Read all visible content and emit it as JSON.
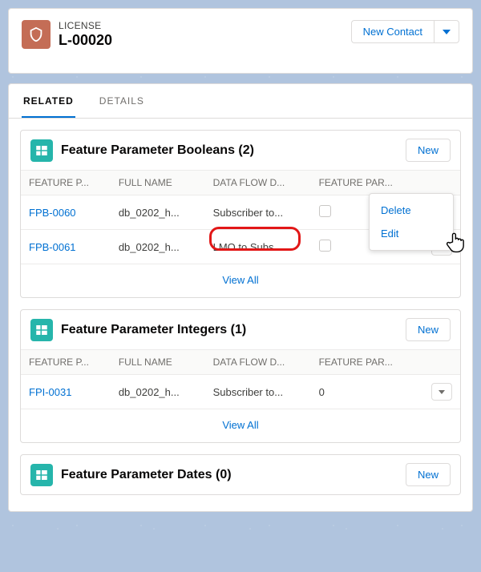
{
  "header": {
    "object_label": "LICENSE",
    "record_name": "L-00020",
    "new_contact_label": "New Contact"
  },
  "tabs": {
    "related": "RELATED",
    "details": "DETAILS"
  },
  "actions": {
    "new": "New",
    "delete": "Delete",
    "edit": "Edit",
    "view_all": "View All"
  },
  "columns": {
    "feature_p": "FEATURE P...",
    "full_name": "FULL NAME",
    "data_flow": "DATA FLOW D...",
    "feature_par": "FEATURE PAR..."
  },
  "booleans": {
    "title": "Feature Parameter Booleans (2)",
    "rows": [
      {
        "name": "FPB-0060",
        "full_name": "db_0202_h...",
        "data_flow": "Subscriber to...",
        "checked": false
      },
      {
        "name": "FPB-0061",
        "full_name": "db_0202_h...",
        "data_flow": "LMO to Subs...",
        "checked": false
      }
    ]
  },
  "integers": {
    "title": "Feature Parameter Integers (1)",
    "rows": [
      {
        "name": "FPI-0031",
        "full_name": "db_0202_h...",
        "data_flow": "Subscriber to...",
        "value": "0"
      }
    ]
  },
  "dates": {
    "title": "Feature Parameter Dates (0)"
  }
}
